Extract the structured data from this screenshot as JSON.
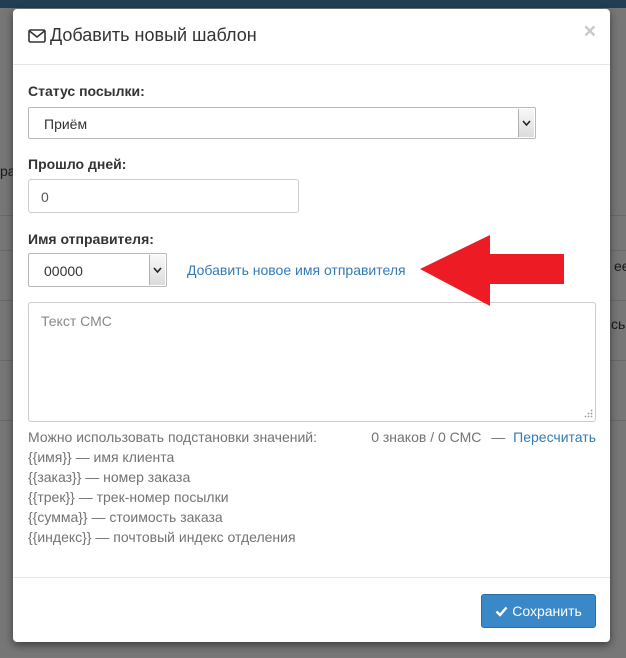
{
  "background": {
    "fragments": [
      "ра",
      "ее",
      "сь"
    ]
  },
  "modal": {
    "title": "Добавить новый шаблон",
    "close_label": "×",
    "status": {
      "label": "Статус посылки:",
      "selected": "Приём"
    },
    "days": {
      "label": "Прошло дней:",
      "value": "0"
    },
    "sender": {
      "label": "Имя отправителя:",
      "selected": "00000",
      "add_link": "Добавить новое имя отправителя"
    },
    "sms": {
      "placeholder": "Текст СМС"
    },
    "counter": {
      "text": "0 знаков / 0 СМС",
      "separator": "—",
      "recalc_link": "Пересчитать"
    },
    "help": {
      "intro": "Можно использовать подстановки значений:",
      "lines": [
        "{{имя}} — имя клиента",
        "{{заказ}} — номер заказа",
        "{{трек}} — трек-номер посылки",
        "{{сумма}} — стоимость заказа",
        "{{индекс}} — почтовый индекс отделения"
      ]
    },
    "save_label": "Сохранить"
  },
  "colors": {
    "accent": "#337ab7",
    "save_button": "#3a88c8",
    "annotation_arrow": "#ed1c24"
  }
}
